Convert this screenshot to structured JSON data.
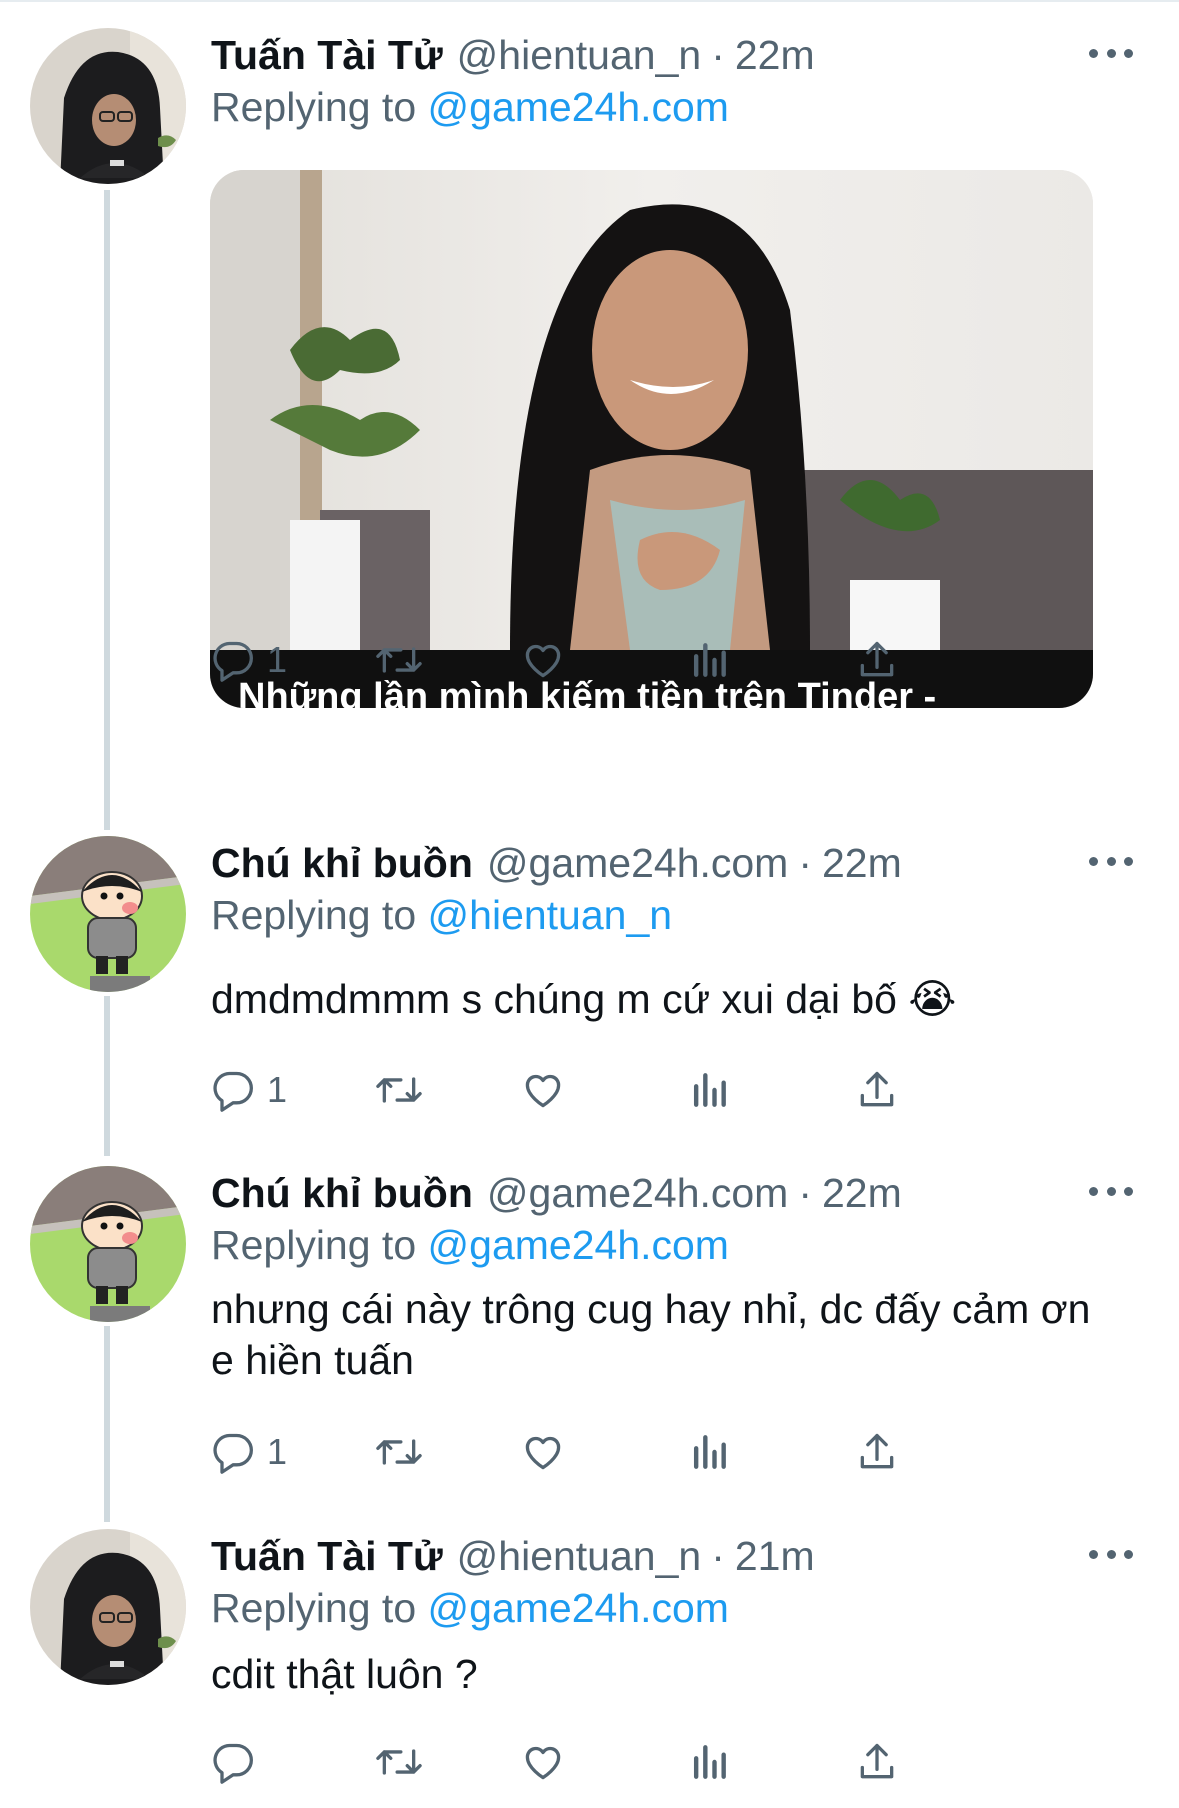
{
  "tweets": [
    {
      "name": "Tuấn Tài Tử",
      "handle": "@hientuan_n",
      "separator": "·",
      "time": "22m",
      "replying_label": "Replying to",
      "replying_to": "@game24h.com",
      "media_caption": "Những lần mình kiếm tiền trên Tinder -",
      "actions": {
        "reply_count": "1"
      }
    },
    {
      "name": "Chú khỉ buồn",
      "handle": "@game24h.com",
      "separator": "·",
      "time": "22m",
      "replying_label": "Replying to",
      "replying_to": "@hientuan_n",
      "text": "dmdmdmmm s chúng m cứ xui dại bố 😭",
      "actions": {
        "reply_count": "1"
      }
    },
    {
      "name": "Chú khỉ buồn",
      "handle": "@game24h.com",
      "separator": "·",
      "time": "22m",
      "replying_label": "Replying to",
      "replying_to": "@game24h.com",
      "text": "nhưng cái này trông cug hay nhỉ, dc đấy cảm ơn e hiền tuấn",
      "actions": {
        "reply_count": "1"
      }
    },
    {
      "name": "Tuấn Tài Tử",
      "handle": "@hientuan_n",
      "separator": "·",
      "time": "21m",
      "replying_label": "Replying to",
      "replying_to": "@game24h.com",
      "text": "cdit thật luôn ?",
      "actions": {
        "reply_count": ""
      }
    }
  ],
  "icons": {
    "reply": "reply-icon",
    "retweet": "retweet-icon",
    "like": "heart-icon",
    "views": "views-icon",
    "share": "share-icon",
    "more": "more-icon"
  },
  "colors": {
    "accent": "#1d9bf0",
    "secondary_text": "#536471",
    "thread_line": "#cfd9de"
  }
}
